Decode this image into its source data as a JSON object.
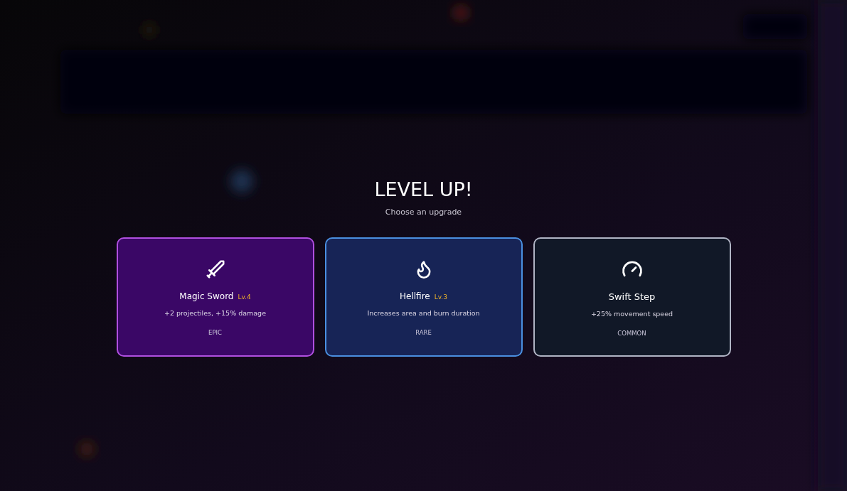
{
  "title": "LEVEL UP!",
  "subtitle": "Choose an upgrade",
  "cards": [
    {
      "kind": "epic",
      "name": "Magic Sword",
      "level": "Lv.4",
      "description": "+2 projectiles, +15% damage",
      "rarity": "EPIC"
    },
    {
      "kind": "rare",
      "name": "Hellfire",
      "level": "Lv.3",
      "description": "Increases area and burn duration",
      "rarity": "RARE"
    },
    {
      "kind": "common",
      "name": "Swift Step",
      "description": "+25% movement speed",
      "rarity": "COMMON"
    }
  ]
}
